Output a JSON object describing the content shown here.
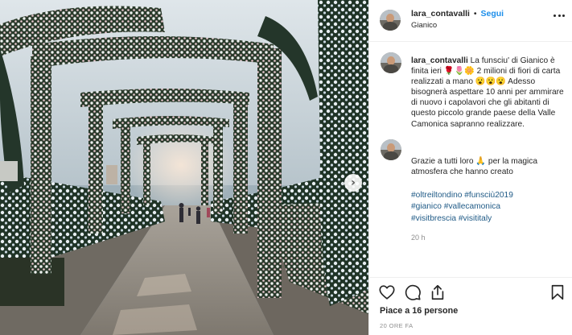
{
  "post": {
    "photo_alt": "",
    "next_glyph": "›",
    "header": {
      "username": "lara_contavalli",
      "separator": "•",
      "follow_label": "Segui",
      "location": "Gianico",
      "more_icon": "more-horizontal-icon"
    },
    "caption": {
      "username": "lara_contavalli",
      "text": "La funsciu' di Gianico è finita ieri 🌹🌷🌼 2 milioni di fiori di carta realizzati a mano 😮😮😮 Adesso bisognerà aspettare 10 anni per ammirare di nuovo i capolavori che gli abitanti di questo piccolo grande paese della Valle Camonica sapranno realizzare."
    },
    "comment": {
      "text": "Grazie a tutti loro 🙏 per la magica atmosfera che hanno creato"
    },
    "hashtags": [
      "#oltreiltondino #funsciù2019",
      "#gianico #vallecamonica",
      "#visitbrescia #visititaly"
    ],
    "comment_time": "20 h",
    "actions": {
      "like_icon": "heart-icon",
      "comment_icon": "comment-icon",
      "share_icon": "share-icon",
      "save_icon": "bookmark-icon"
    },
    "likes_text": "Piace a 16 persone",
    "post_time": "20 ORE FA"
  }
}
